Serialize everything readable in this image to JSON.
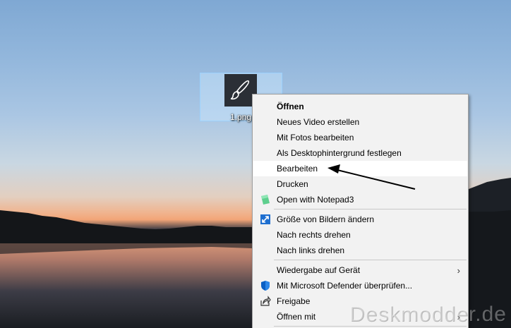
{
  "desktop": {
    "file_icon": {
      "name": "1.png",
      "icon": "paintbrush-icon"
    },
    "watermark": "Deskmodder.de"
  },
  "context_menu": {
    "items": [
      {
        "label": "Öffnen",
        "bold": true
      },
      {
        "label": "Neues Video erstellen"
      },
      {
        "label": "Mit Fotos bearbeiten"
      },
      {
        "label": "Als Desktophintergrund festlegen"
      },
      {
        "label": "Bearbeiten",
        "highlighted": true
      },
      {
        "label": "Drucken"
      },
      {
        "label": "Open with Notepad3",
        "icon": "notepad3-icon"
      },
      {
        "label": "Größe von Bildern ändern",
        "icon": "resize-images-icon"
      },
      {
        "label": "Nach rechts drehen"
      },
      {
        "label": "Nach links drehen"
      },
      {
        "label": "Wiedergabe auf Gerät",
        "submenu": true
      },
      {
        "label": "Mit Microsoft Defender überprüfen...",
        "icon": "defender-shield-icon"
      },
      {
        "label": "Freigabe",
        "icon": "share-icon"
      },
      {
        "label": "Öffnen mit",
        "submenu": true
      }
    ]
  },
  "annotation": {
    "arrow_color": "#000000",
    "points_to": "Bearbeiten"
  },
  "colors": {
    "menu_background": "#f2f2f2",
    "highlight": "#ffffff",
    "selection_fill": "#cce8ff"
  }
}
